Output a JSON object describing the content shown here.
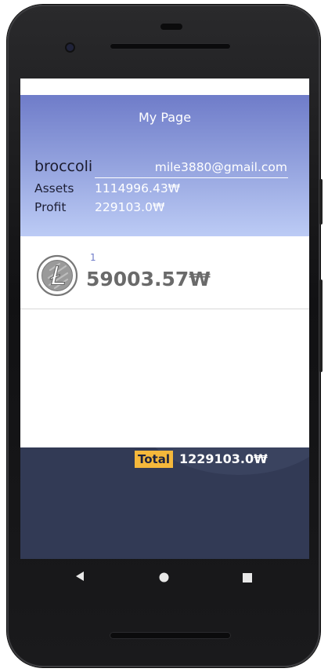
{
  "header": {
    "title": "My Page",
    "username": "broccoli",
    "email": "mile3880@gmail.com",
    "assets_label": "Assets",
    "assets_value": "1114996.43₩",
    "profit_label": "Profit",
    "profit_value": "229103.0₩"
  },
  "holdings": [
    {
      "icon": "litecoin-icon",
      "count": "1",
      "value": "59003.57₩"
    }
  ],
  "footer": {
    "total_label": "Total",
    "total_value": "1229103.0₩"
  },
  "navbar": {
    "back": "back-icon",
    "home": "home-icon",
    "recents": "recents-icon"
  },
  "colors": {
    "header_top": "#6f7cc9",
    "header_bottom": "#bccbf5",
    "footer_bg": "#323a55",
    "total_badge": "#f5b83b",
    "coin_count": "#6f7cc9"
  }
}
